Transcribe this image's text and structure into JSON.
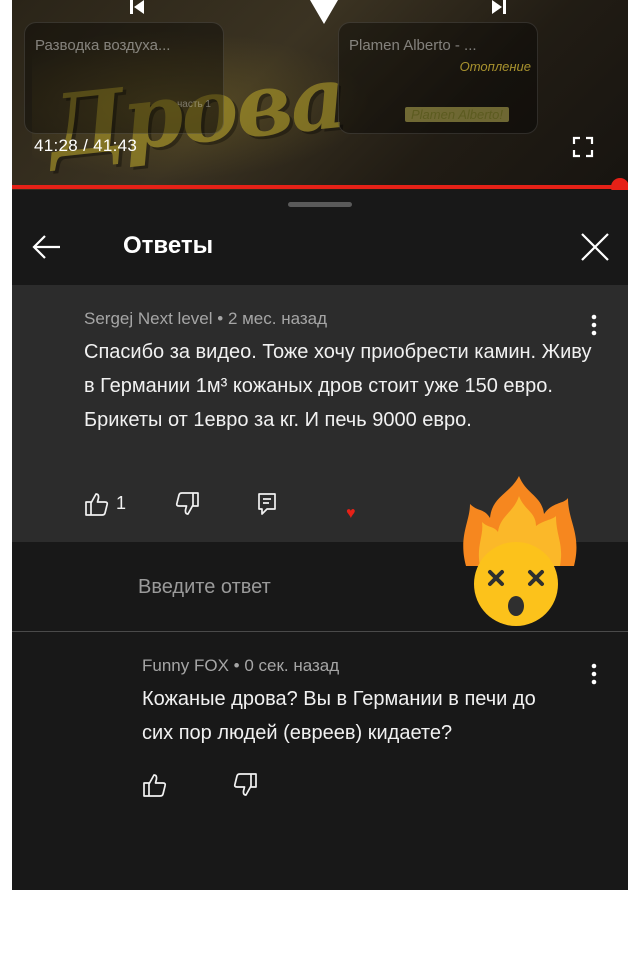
{
  "video": {
    "watermark": "Дрова",
    "time": "41:28 / 41:43",
    "progress_fraction": 0.997,
    "suggestions": [
      {
        "title": "Разводка воздуха...",
        "subtitle": "часть 1"
      },
      {
        "title": "Plamen Alberto - ...",
        "subtitle": "Отопление",
        "caption": "Plamen Alberto!"
      }
    ]
  },
  "panel": {
    "title": "Ответы"
  },
  "parent_comment": {
    "author": "Sergej Next level",
    "time": "2 мес. назад",
    "text": "Спасибо за видео.  Тоже хочу приобрести камин. Живу в Германии 1м³ кожаных дров стоит уже 150 евро. Брикеты от 1евро за кг. И печь 9000 евро.",
    "likes": "1"
  },
  "reply_input": {
    "placeholder": "Введите ответ"
  },
  "reply_comment": {
    "author": "Funny FOX",
    "time": "0 сек. назад",
    "text": "Кожаные дрова? Вы в Германии в печи до сих пор людей (евреев) кидаете?"
  },
  "colors": {
    "accent": "#e62117",
    "background": "#181818",
    "highlight": "#2c2c2c"
  },
  "icons": [
    "arrow-left-icon",
    "close-icon",
    "more-vert-icon",
    "thumbs-up-icon",
    "thumbs-down-icon",
    "reply-icon",
    "heart-icon",
    "fullscreen-icon",
    "exploding-head-emoji"
  ]
}
